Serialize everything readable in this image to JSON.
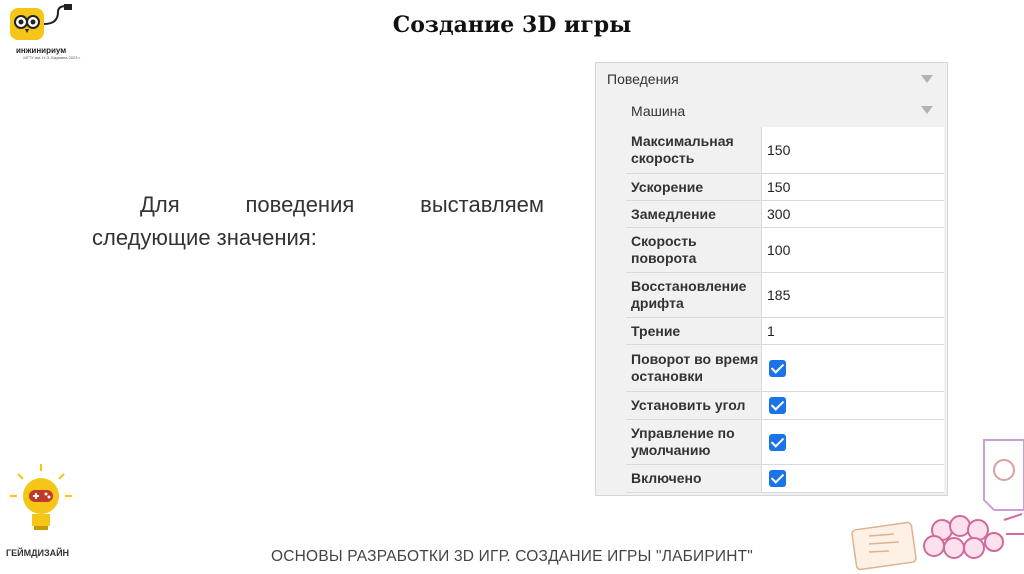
{
  "logo": {
    "name": "инжинириум",
    "subtitle": "МГТУ им. Н.Э. Баумана 2023 г."
  },
  "title": "Создание 3D игры",
  "body_text": "Для поведения выставляем следующие значения:",
  "panel": {
    "header": "Поведения",
    "subheader": "Машина",
    "rows": [
      {
        "label": "Максимальная скорость",
        "value": "150"
      },
      {
        "label": "Ускорение",
        "value": "150"
      },
      {
        "label": "Замедление",
        "value": "300"
      },
      {
        "label": "Скорость поворота",
        "value": "100"
      },
      {
        "label": "Восстановление дрифта",
        "value": "185"
      },
      {
        "label": "Трение",
        "value": "1"
      },
      {
        "label": "Поворот во время остановки",
        "checked": true
      },
      {
        "label": "Установить угол",
        "checked": true
      },
      {
        "label": "Управление по умолчанию",
        "checked": true
      },
      {
        "label": "Включено",
        "checked": true
      }
    ]
  },
  "bulb_label": "ГЕЙМДИЗАЙН",
  "footer": "ОСНОВЫ РАЗРАБОТКИ 3D ИГР. СОЗДАНИЕ ИГРЫ \"ЛАБИРИНТ\"",
  "colors": {
    "accent": "#1a73e8",
    "logo_yellow": "#f5c518"
  }
}
